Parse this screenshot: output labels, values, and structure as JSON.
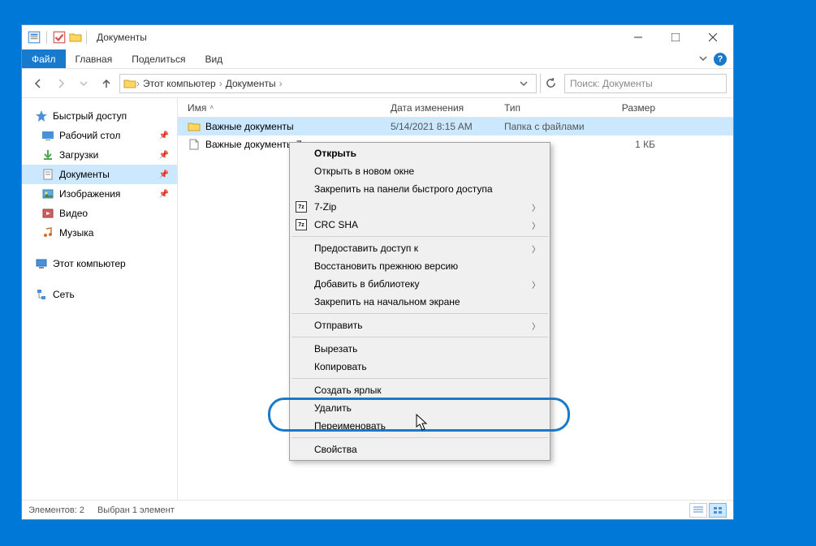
{
  "window": {
    "title": "Документы"
  },
  "ribbon": {
    "file": "Файл",
    "tabs": [
      "Главная",
      "Поделиться",
      "Вид"
    ]
  },
  "breadcrumb": {
    "parts": [
      "Этот компьютер",
      "Документы"
    ]
  },
  "search": {
    "placeholder": "Поиск: Документы"
  },
  "sidebar": {
    "quick_access": "Быстрый доступ",
    "items": [
      {
        "label": "Рабочий стол",
        "pin": true
      },
      {
        "label": "Загрузки",
        "pin": true
      },
      {
        "label": "Документы",
        "pin": true,
        "active": true
      },
      {
        "label": "Изображения",
        "pin": true
      },
      {
        "label": "Видео",
        "pin": false
      },
      {
        "label": "Музыка",
        "pin": false
      }
    ],
    "this_pc": "Этот компьютер",
    "network": "Сеть"
  },
  "columns": {
    "name": "Имя",
    "date": "Дата изменения",
    "type": "Тип",
    "size": "Размер"
  },
  "files": [
    {
      "name": "Важные документы",
      "date": "5/14/2021 8:15 AM",
      "type": "Папка с файлами",
      "size": "",
      "icon": "folder",
      "selected": true
    },
    {
      "name": "Важные документы.7z",
      "date": "",
      "type": "",
      "size": "1 КБ",
      "icon": "file",
      "selected": false
    }
  ],
  "context_menu": {
    "open": "Открыть",
    "open_new": "Открыть в новом окне",
    "pin_quick": "Закрепить на панели быстрого доступа",
    "seven_zip": "7-Zip",
    "crc_sha": "CRC SHA",
    "grant_access": "Предоставить доступ к",
    "restore_prev": "Восстановить прежнюю версию",
    "add_library": "Добавить в библиотеку",
    "pin_start": "Закрепить на начальном экране",
    "send_to": "Отправить",
    "cut": "Вырезать",
    "copy": "Копировать",
    "create_shortcut": "Создать ярлык",
    "delete": "Удалить",
    "rename": "Переименовать",
    "properties": "Свойства"
  },
  "status": {
    "count": "Элементов: 2",
    "selection": "Выбран 1 элемент"
  }
}
